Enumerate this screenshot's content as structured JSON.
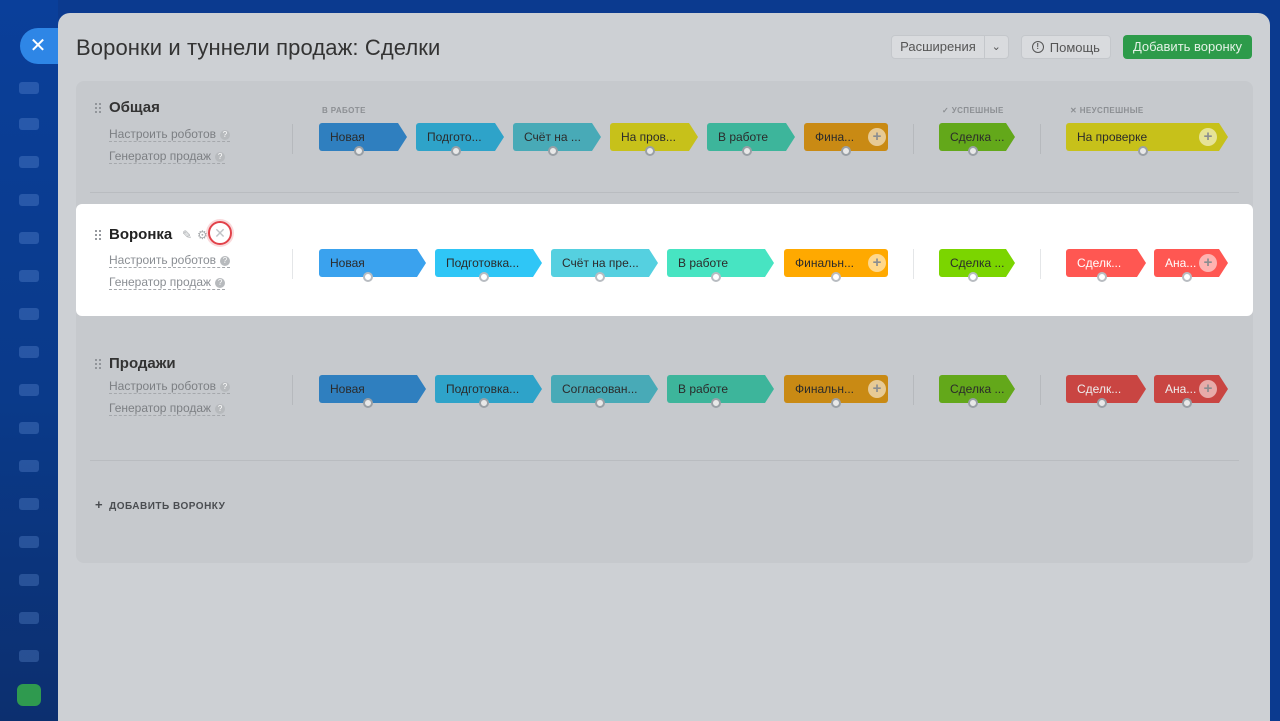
{
  "app": {
    "close_icon": "close-icon"
  },
  "header": {
    "title": "Воронки и туннели продаж: Сделки",
    "extensions_label": "Расширения",
    "help_label": "Помощь",
    "add_funnel_label": "Добавить воронку"
  },
  "groups": {
    "in_work": "В РАБОТЕ",
    "success": "УСПЕШНЫЕ",
    "fail": "НЕУСПЕШНЫЕ"
  },
  "funnels": [
    {
      "name": "Общая",
      "robots": "Настроить роботов",
      "generator": "Генератор продаж",
      "stages": [
        "Новая",
        "Подгото...",
        "Счёт на ...",
        "На пров...",
        "В работе",
        "Фина..."
      ],
      "success": "Сделка ...",
      "fail": [
        "На проверке"
      ]
    },
    {
      "name": "Воронка",
      "robots": "Настроить роботов",
      "generator": "Генератор продаж",
      "stages": [
        "Новая",
        "Подготовка...",
        "Счёт на пре...",
        "В работе",
        "Финальн..."
      ],
      "success": "Сделка ...",
      "fail": [
        "Сделк...",
        "Ана..."
      ]
    },
    {
      "name": "Продажи",
      "robots": "Настроить роботов",
      "generator": "Генератор продаж",
      "stages": [
        "Новая",
        "Подготовка...",
        "Согласован...",
        "В работе",
        "Финальн..."
      ],
      "success": "Сделка ...",
      "fail": [
        "Сделк...",
        "Ана..."
      ]
    }
  ],
  "add_funnel_link": "ДОБАВИТЬ ВОРОНКУ",
  "colors": {
    "accent_green": "#2d9b4a",
    "delete_highlight": "#e2424a",
    "stage_blue": "#3aa2ee",
    "stage_cyan": "#2fc6f6",
    "stage_teal": "#55d0e0",
    "stage_yellow": "#fff200",
    "stage_mint": "#47e4c2",
    "stage_orange": "#ffa900",
    "stage_green": "#7bd500",
    "stage_red": "#ff5752"
  }
}
